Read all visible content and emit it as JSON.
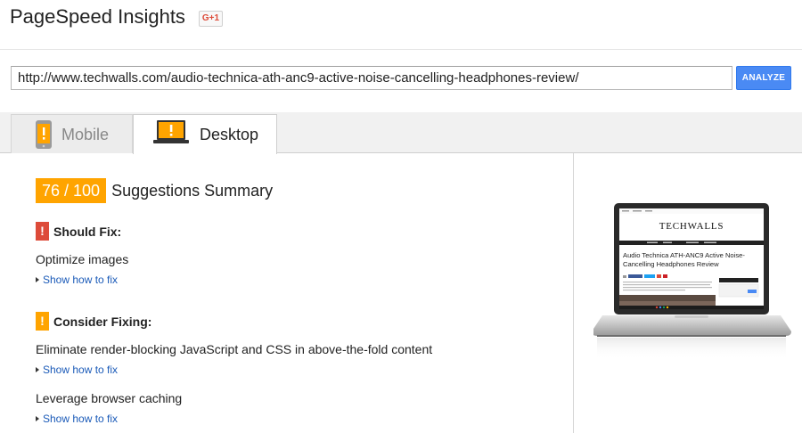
{
  "header": {
    "title": "PageSpeed Insights",
    "gplus_label": "G+1"
  },
  "search": {
    "url": "http://www.techwalls.com/audio-technica-ath-anc9-active-noise-cancelling-headphones-review/",
    "analyze_label": "ANALYZE"
  },
  "tabs": [
    {
      "label": "Mobile",
      "icon": "mobile-warning-icon",
      "active": false
    },
    {
      "label": "Desktop",
      "icon": "laptop-warning-icon",
      "active": true
    }
  ],
  "summary": {
    "score": "76 / 100",
    "title": "Suggestions Summary",
    "score_color": "#ffa400"
  },
  "should_fix": {
    "heading": "Should Fix:",
    "icon_color": "#dd4b39",
    "rules": [
      {
        "title": "Optimize images",
        "link": "Show how to fix"
      }
    ]
  },
  "consider_fixing": {
    "heading": "Consider Fixing:",
    "icon_color": "#ffa400",
    "rules": [
      {
        "title": "Eliminate render-blocking JavaScript and CSS in above-the-fold content",
        "link": "Show how to fix"
      },
      {
        "title": "Leverage browser caching",
        "link": "Show how to fix"
      }
    ]
  },
  "preview": {
    "site_name": "TECHWALLS",
    "article_title": "Audio Technica ATH-ANC9 Active Noise-Cancelling Headphones Review"
  }
}
